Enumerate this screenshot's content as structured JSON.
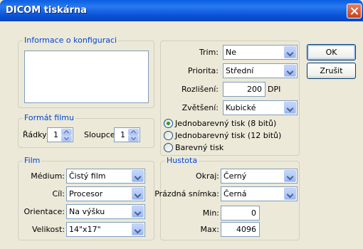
{
  "window": {
    "title": "DICOM tiskárna"
  },
  "buttons": {
    "ok": "OK",
    "cancel": "Zrušit"
  },
  "config_group": {
    "title": "Informace o konfiguraci"
  },
  "film_format": {
    "title": "Formát filmu",
    "rows_label": "Řádky:",
    "rows_value": "1",
    "cols_label": "Sloupce:",
    "cols_value": "1"
  },
  "film": {
    "title": "Film",
    "medium_label": "Médium:",
    "medium_value": "Čistý film",
    "target_label": "Cíl:",
    "target_value": "Procesor",
    "orientation_label": "Orientace:",
    "orientation_value": "Na výšku",
    "size_label": "Velikost:",
    "size_value": "14\"x17\""
  },
  "print": {
    "trim_label": "Trim:",
    "trim_value": "Ne",
    "priority_label": "Priorita:",
    "priority_value": "Střední",
    "resolution_label": "Rozlišení:",
    "resolution_value": "200",
    "resolution_unit": "DPI",
    "magnify_label": "Zvětšení:",
    "magnify_value": "Kubické",
    "radio_mono8": "Jednobarevný tisk (8 bitů)",
    "radio_mono12": "Jednobarevný tisk (12 bitů)",
    "radio_color": "Barevný tisk",
    "selected_mode": "mono8"
  },
  "density": {
    "title": "Hustota",
    "border_label": "Okraj:",
    "border_value": "Černý",
    "empty_label": "Prázdná snímka:",
    "empty_value": "Černá",
    "min_label": "Min:",
    "min_value": "0",
    "max_label": "Max:",
    "max_value": "4096"
  }
}
